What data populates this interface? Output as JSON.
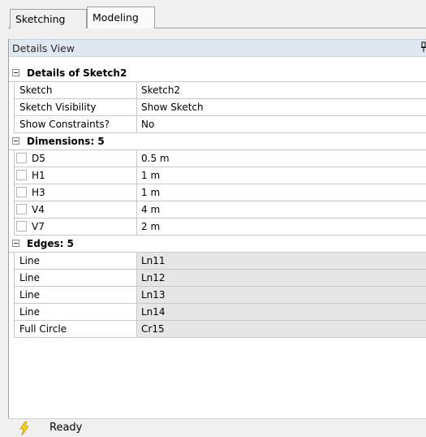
{
  "tabs": {
    "sketching": "Sketching",
    "modeling": "Modeling"
  },
  "panel": {
    "title": "Details View"
  },
  "details": {
    "header": "Details of Sketch2",
    "rows": [
      {
        "name": "Sketch",
        "value": "Sketch2"
      },
      {
        "name": "Sketch Visibility",
        "value": "Show Sketch"
      },
      {
        "name": "Show Constraints?",
        "value": "No"
      }
    ]
  },
  "dimensions": {
    "header": "Dimensions: 5",
    "rows": [
      {
        "name": "D5",
        "value": "0.5 m"
      },
      {
        "name": "H1",
        "value": "1 m"
      },
      {
        "name": "H3",
        "value": "1 m"
      },
      {
        "name": "V4",
        "value": "4 m"
      },
      {
        "name": "V7",
        "value": "2 m"
      }
    ]
  },
  "edges": {
    "header": "Edges: 5",
    "rows": [
      {
        "name": "Line",
        "value": "Ln11"
      },
      {
        "name": "Line",
        "value": "Ln12"
      },
      {
        "name": "Line",
        "value": "Ln13"
      },
      {
        "name": "Line",
        "value": "Ln14"
      },
      {
        "name": "Full Circle",
        "value": "Cr15"
      }
    ]
  },
  "status": {
    "text": "Ready",
    "icon": "lightning-icon",
    "icon_color": "#f5d21b"
  },
  "colors": {
    "header_bg": "#dfe7f1",
    "readonly_cell": "#e6e6e6",
    "grid_line": "#c8c8c8"
  }
}
